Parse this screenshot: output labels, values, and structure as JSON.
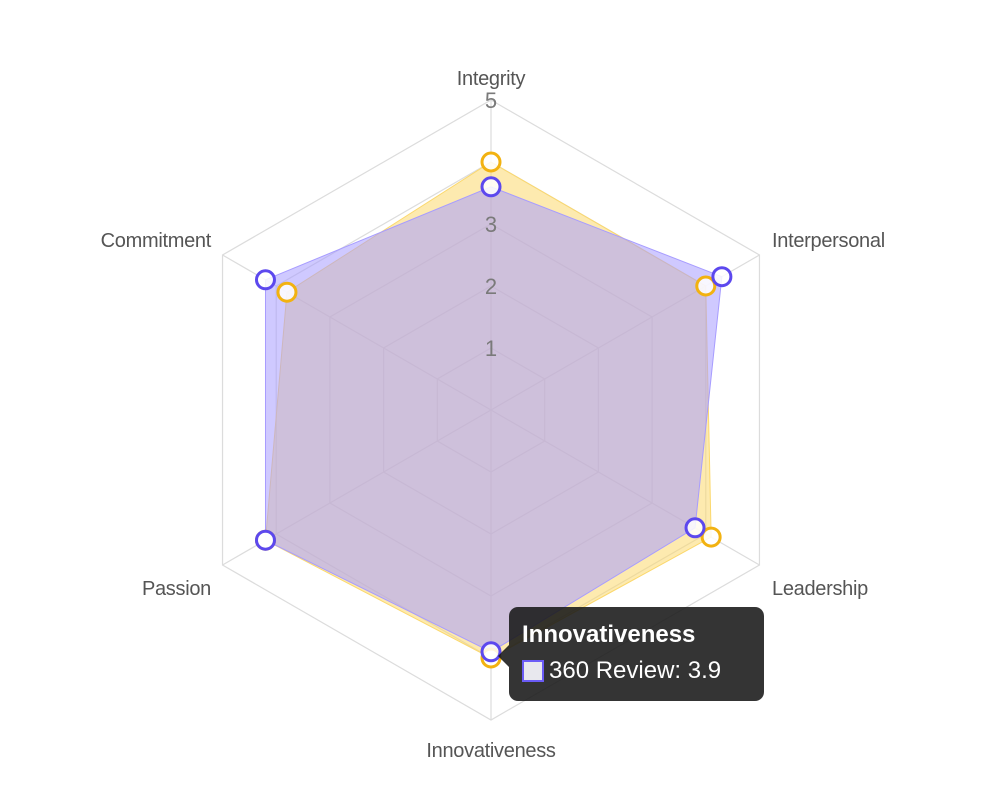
{
  "chart_data": {
    "type": "radar",
    "categories": [
      "Integrity",
      "Interpersonal",
      "Leadership",
      "Innovativeness",
      "Passion",
      "Commitment"
    ],
    "r_ticks": [
      "1",
      "2",
      "3",
      "5"
    ],
    "r_range": [
      0,
      5
    ],
    "grid": true,
    "series": [
      {
        "name": "",
        "values": [
          4.0,
          4.0,
          4.1,
          4.0,
          4.2,
          3.8
        ],
        "line_color": "#f2b211",
        "fill_color": "#fbd86d"
      },
      {
        "name": "360 Review",
        "values": [
          3.6,
          4.3,
          3.8,
          3.9,
          4.2,
          4.2
        ],
        "line_color": "#5c48ee",
        "fill_color": "#a79cff"
      }
    ],
    "tooltip": {
      "title": "Innovativeness",
      "text": "360 Review: 3.9"
    }
  }
}
